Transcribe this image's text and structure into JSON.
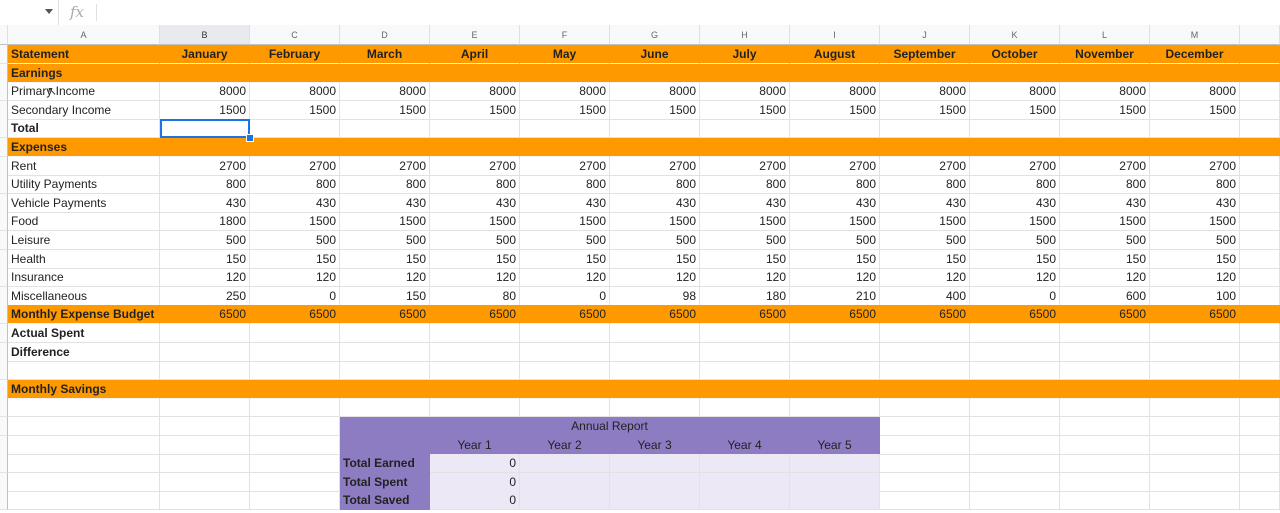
{
  "formula_bar": {
    "fx_label": "fx",
    "value": ""
  },
  "columns": [
    "A",
    "B",
    "C",
    "D",
    "E",
    "F",
    "G",
    "H",
    "I",
    "J",
    "K",
    "L",
    "M"
  ],
  "selected_column": "B",
  "header_row": {
    "label": "Statement",
    "months": [
      "January",
      "February",
      "March",
      "April",
      "May",
      "June",
      "July",
      "August",
      "September",
      "October",
      "November",
      "December"
    ]
  },
  "earnings": {
    "section_label": "Earnings",
    "rows": [
      {
        "label": "Primary Income",
        "values": [
          "8000",
          "8000",
          "8000",
          "8000",
          "8000",
          "8000",
          "8000",
          "8000",
          "8000",
          "8000",
          "8000",
          "8000"
        ]
      },
      {
        "label": "Secondary Income",
        "values": [
          "1500",
          "1500",
          "1500",
          "1500",
          "1500",
          "1500",
          "1500",
          "1500",
          "1500",
          "1500",
          "1500",
          "1500"
        ]
      }
    ],
    "total_label": "Total"
  },
  "expenses": {
    "section_label": "Expenses",
    "rows": [
      {
        "label": "Rent",
        "values": [
          "2700",
          "2700",
          "2700",
          "2700",
          "2700",
          "2700",
          "2700",
          "2700",
          "2700",
          "2700",
          "2700",
          "2700"
        ]
      },
      {
        "label": "Utility Payments",
        "values": [
          "800",
          "800",
          "800",
          "800",
          "800",
          "800",
          "800",
          "800",
          "800",
          "800",
          "800",
          "800"
        ]
      },
      {
        "label": "Vehicle Payments",
        "values": [
          "430",
          "430",
          "430",
          "430",
          "430",
          "430",
          "430",
          "430",
          "430",
          "430",
          "430",
          "430"
        ]
      },
      {
        "label": "Food",
        "values": [
          "1800",
          "1500",
          "1500",
          "1500",
          "1500",
          "1500",
          "1500",
          "1500",
          "1500",
          "1500",
          "1500",
          "1500"
        ]
      },
      {
        "label": "Leisure",
        "values": [
          "500",
          "500",
          "500",
          "500",
          "500",
          "500",
          "500",
          "500",
          "500",
          "500",
          "500",
          "500"
        ]
      },
      {
        "label": "Health",
        "values": [
          "150",
          "150",
          "150",
          "150",
          "150",
          "150",
          "150",
          "150",
          "150",
          "150",
          "150",
          "150"
        ]
      },
      {
        "label": "Insurance",
        "values": [
          "120",
          "120",
          "120",
          "120",
          "120",
          "120",
          "120",
          "120",
          "120",
          "120",
          "120",
          "120"
        ]
      },
      {
        "label": "Miscellaneous",
        "values": [
          "250",
          "0",
          "150",
          "80",
          "0",
          "98",
          "180",
          "210",
          "400",
          "0",
          "600",
          "100"
        ]
      }
    ]
  },
  "budget": {
    "label": "Monthly Expense Budget",
    "values": [
      "6500",
      "6500",
      "6500",
      "6500",
      "6500",
      "6500",
      "6500",
      "6500",
      "6500",
      "6500",
      "6500",
      "6500"
    ]
  },
  "actual_spent_label": "Actual Spent",
  "difference_label": "Difference",
  "savings_label": "Monthly Savings",
  "annual_report": {
    "title": "Annual Report",
    "years": [
      "Year 1",
      "Year 2",
      "Year 3",
      "Year 4",
      "Year 5"
    ],
    "rows": [
      {
        "label": "Total Earned",
        "value": "0"
      },
      {
        "label": "Total Spent",
        "value": "0"
      },
      {
        "label": "Total Saved",
        "value": "0"
      }
    ]
  },
  "colors": {
    "orange": "#ff9900",
    "purple": "#8e7cc3",
    "lilac": "#ece8f6",
    "selection": "#1a73e8"
  }
}
